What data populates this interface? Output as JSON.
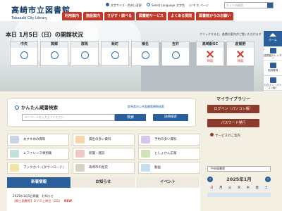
{
  "logo": {
    "jp": "高崎市立図書館",
    "en": "Takasaki City Library"
  },
  "tools": {
    "font_size": "文字サイズ・色合い変更",
    "language": "Select Language",
    "contrast_label": "文字色",
    "sizes": [
      "小",
      "中",
      "大"
    ],
    "sizes_label": "ページ",
    "search_placeholder": "サイト内検索"
  },
  "nav": [
    "利用案内",
    "施設案内",
    "さがす・調べる",
    "図書館サービス",
    "よくある質問",
    "図書館からのお願い"
  ],
  "hero": {
    "title": "本日 1月5日（日）の開館状況",
    "note": "クリックすると、各館の案内がご覧いただけます",
    "branches": [
      {
        "name": "中央",
        "status": "open"
      },
      {
        "name": "箕郷",
        "status": "open"
      },
      {
        "name": "群馬",
        "status": "open"
      },
      {
        "name": "新町",
        "status": "open"
      },
      {
        "name": "榛名",
        "status": "open"
      },
      {
        "name": "吉井",
        "status": "open"
      }
    ],
    "closed_branches": [
      {
        "name": "高崎駅SC",
        "label": "休館"
      },
      {
        "name": "倉賀野",
        "label": "休館"
      }
    ]
  },
  "sidebar": {
    "home": "ホーム",
    "items": [
      "図書館カレンダー",
      "利用登録",
      "ログイン（パソコン版）"
    ]
  },
  "search": {
    "title": "かんたん蔵書検索",
    "link": "群馬県内公共図書館横断検索",
    "placeholder": "キーワードを入力してください",
    "button": "検索",
    "detail": "詳細検索"
  },
  "mylib": {
    "title": "マイライブラリー",
    "login": "ログイン（パソコン版）",
    "password": "パスワード発行",
    "guide": "サービスのご案内"
  },
  "grid": [
    {
      "label": "おすすめの資料",
      "color": "#c9d4e8"
    },
    {
      "label": "貸出の多い資料",
      "color": "#f6d7a8"
    },
    {
      "label": "予約の多い資料",
      "color": "#d7c6e6"
    },
    {
      "label": "レファレンス事例集",
      "color": "#c2e1d8"
    },
    {
      "label": "新聞・雑誌",
      "color": "#f0c8c8"
    },
    {
      "label": "としょかん広報",
      "color": "#cfe3b8"
    },
    {
      "label": "ブックカバー(ダウンロード)",
      "color": "#f5e4a8"
    },
    {
      "label": "高崎市の歴史",
      "color": "#d9d0c6"
    },
    {
      "label": "動画",
      "color": "#c6dcef"
    }
  ],
  "tabs": [
    "新着情報",
    "お知らせ",
    "イベント"
  ],
  "news": [
    {
      "date": "2025年1月5日掲載",
      "tag": "お知らせ"
    },
    {
      "title": "【郷土図書館】ＤＶＤ上映会（2月）",
      "badge": "NEW"
    }
  ],
  "calendar": {
    "select": "中央図書館",
    "month": "2025年1月",
    "days": [
      "日",
      "月",
      "火",
      "水",
      "木",
      "金",
      "土"
    ]
  }
}
